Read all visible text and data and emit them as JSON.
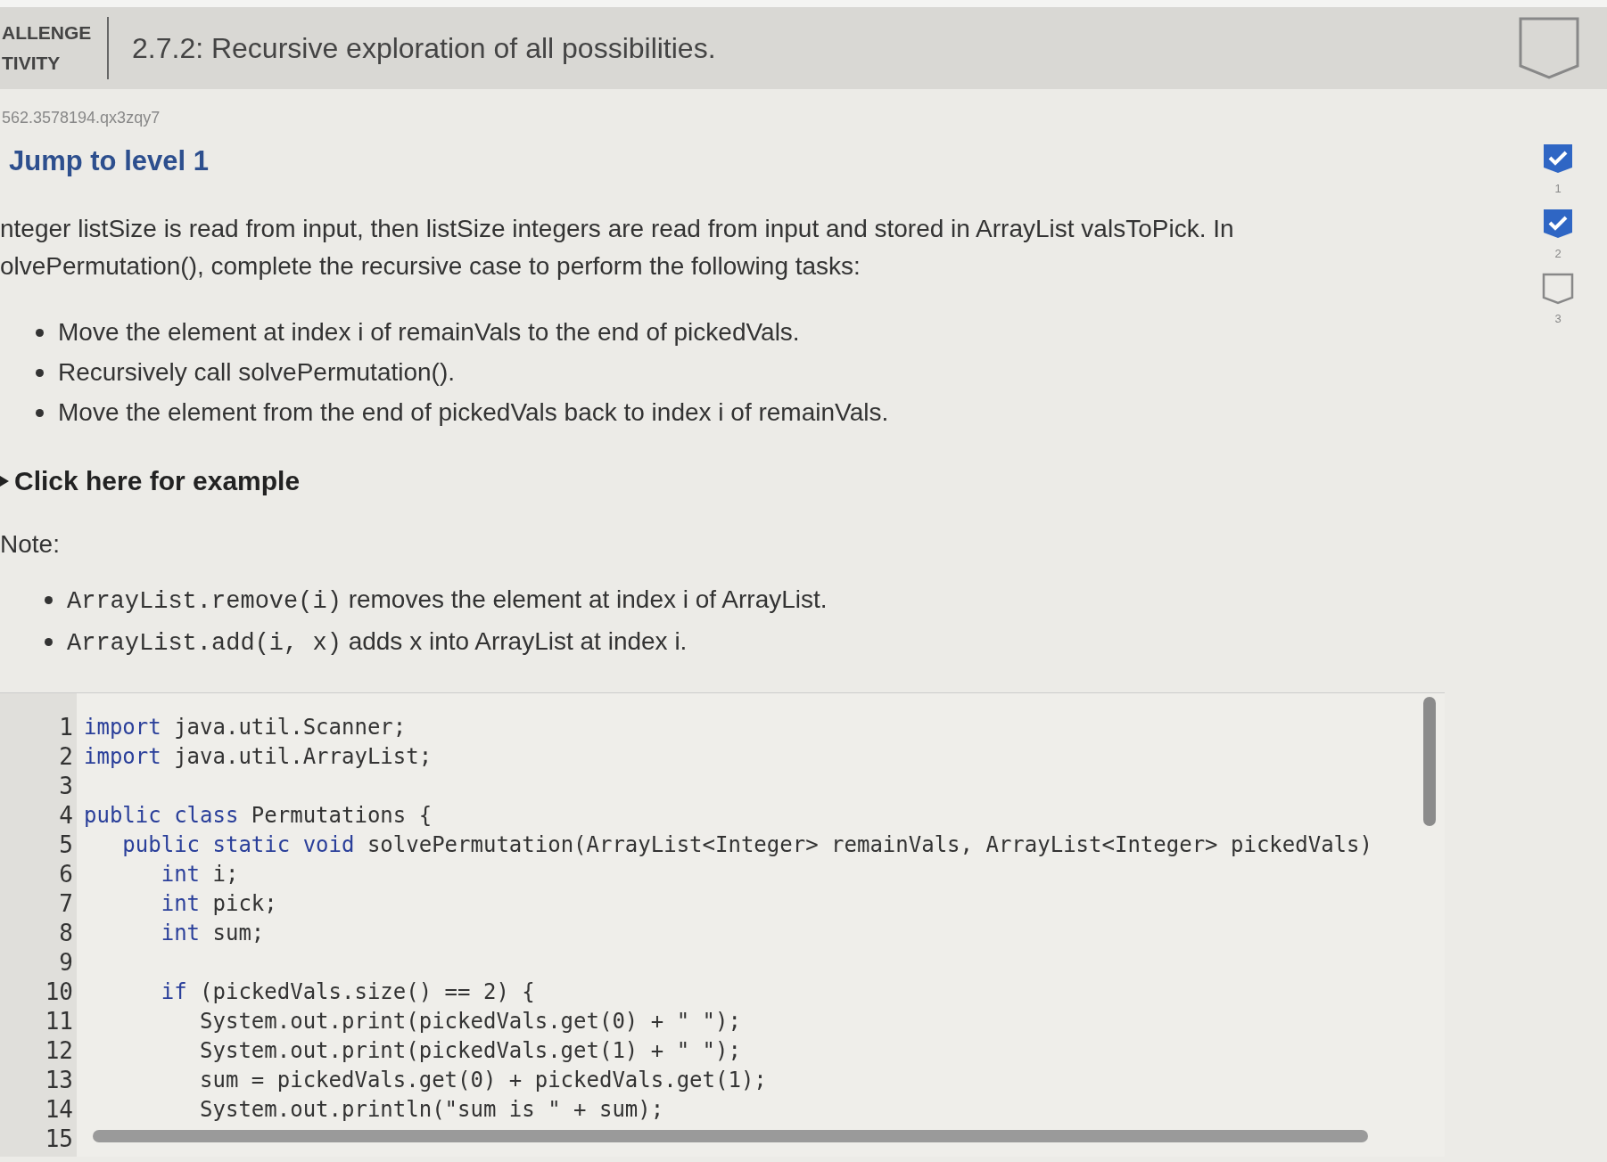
{
  "header": {
    "activity_label": [
      "ALLENGE",
      "TIVITY"
    ],
    "title": "2.7.2: Recursive exploration of all possibilities.",
    "completed": false
  },
  "activity_id": "562.3578194.qx3zqy7",
  "jump_link": "Jump to level 1",
  "levels": [
    {
      "label": "1",
      "completed": true
    },
    {
      "label": "2",
      "completed": true
    },
    {
      "label": "3",
      "completed": false
    }
  ],
  "description": [
    "nteger listSize is read from input, then listSize integers are read from input and stored in ArrayList valsToPick. In",
    "olvePermutation(), complete the recursive case to perform the following tasks:"
  ],
  "tasks": [
    "Move the element at index i of remainVals to the end of pickedVals.",
    "Recursively call solvePermutation().",
    "Move the element from the end of pickedVals back to index i of remainVals."
  ],
  "example_toggle": {
    "label": "Click here for example",
    "expanded": false
  },
  "note_label": "Note:",
  "notes": [
    {
      "code": "ArrayList.remove(i)",
      "text": "removes the element at index i of ArrayList."
    },
    {
      "code": "ArrayList.add(i, x)",
      "text": "adds x into ArrayList at index i."
    }
  ],
  "code_lines": [
    {
      "number": "1",
      "tokens": [
        {
          "kind": "keyword",
          "text": "import"
        },
        {
          "kind": "plain",
          "text": " java.util.Scanner;"
        }
      ]
    },
    {
      "number": "2",
      "tokens": [
        {
          "kind": "keyword",
          "text": "import"
        },
        {
          "kind": "plain",
          "text": " java.util.ArrayList;"
        }
      ]
    },
    {
      "number": "3"
    },
    {
      "number": "4",
      "tokens": [
        {
          "kind": "keyword",
          "text": "public class"
        },
        {
          "kind": "plain",
          "text": " Permutations {"
        }
      ]
    },
    {
      "number": "5",
      "tokens": [
        {
          "kind": "keyword",
          "text": "   public static void"
        },
        {
          "kind": "plain",
          "text": " solvePermutation(ArrayList<Integer> remainVals, ArrayList<Integer> pickedVals)"
        }
      ]
    },
    {
      "number": "6",
      "tokens": [
        {
          "kind": "keyword",
          "text": "      int"
        },
        {
          "kind": "plain",
          "text": " i;"
        }
      ]
    },
    {
      "number": "7",
      "tokens": [
        {
          "kind": "keyword",
          "text": "      int"
        },
        {
          "kind": "plain",
          "text": " pick;"
        }
      ]
    },
    {
      "number": "8",
      "tokens": [
        {
          "kind": "keyword",
          "text": "      int"
        },
        {
          "kind": "plain",
          "text": " sum;"
        }
      ]
    },
    {
      "number": "9"
    },
    {
      "number": "10",
      "tokens": [
        {
          "kind": "keyword",
          "text": "      if"
        },
        {
          "kind": "plain",
          "text": " (pickedVals.size() == 2) {"
        }
      ]
    },
    {
      "number": "11",
      "tokens": [
        {
          "kind": "plain",
          "text": "         System.out.print(pickedVals.get(0) + \" \");"
        }
      ]
    },
    {
      "number": "12",
      "tokens": [
        {
          "kind": "plain",
          "text": "         System.out.print(pickedVals.get(1) + \" \");"
        }
      ]
    },
    {
      "number": "13",
      "tokens": [
        {
          "kind": "plain",
          "text": "         sum = pickedVals.get(0) + pickedVals.get(1);"
        }
      ]
    },
    {
      "number": "14",
      "tokens": [
        {
          "kind": "plain",
          "text": "         System.out.println(\"sum is \" + sum);"
        }
      ]
    },
    {
      "number": "15"
    }
  ]
}
